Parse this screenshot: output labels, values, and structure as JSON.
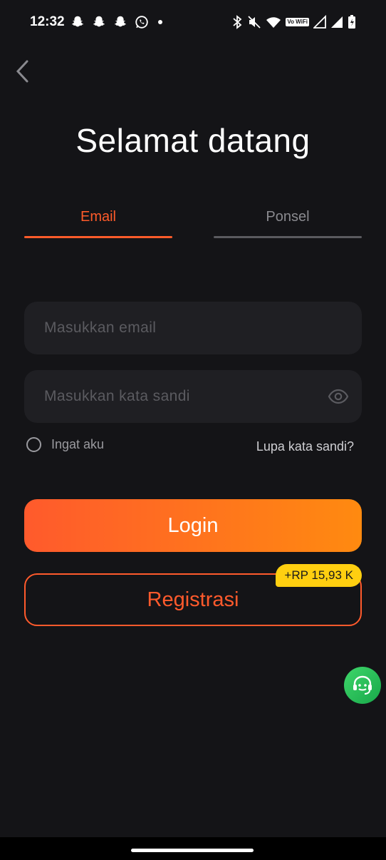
{
  "status_bar": {
    "time": "12:32",
    "left_icons": [
      "snapchat-icon",
      "snapchat-icon",
      "snapchat-icon",
      "whatsapp-icon",
      "dot-icon"
    ],
    "right_icons": [
      "bluetooth-icon",
      "mute-icon",
      "wifi-icon",
      "vowifi-icon",
      "signal-icon",
      "signal-icon",
      "battery-icon"
    ],
    "vowifi_label": "Vo WiFi"
  },
  "header": {
    "title": "Selamat datang"
  },
  "tabs": [
    {
      "label": "Email",
      "active": true
    },
    {
      "label": "Ponsel",
      "active": false
    }
  ],
  "form": {
    "email_placeholder": "Masukkan email",
    "email_value": "",
    "password_placeholder": "Masukkan kata sandi",
    "password_value": "",
    "remember_label": "Ingat aku",
    "remember_checked": false,
    "forgot_label": "Lupa kata sandi?"
  },
  "actions": {
    "login_label": "Login",
    "register_label": "Registrasi",
    "bonus_badge": "+RP 15,93 K"
  },
  "colors": {
    "accent": "#ff5a2c",
    "accent_gradient_end": "#ff8a10",
    "background": "#141417",
    "field_bg": "#1f1f23",
    "badge": "#ffcf10",
    "support": "#2ec35a"
  },
  "support": {
    "icon": "headset-icon"
  }
}
